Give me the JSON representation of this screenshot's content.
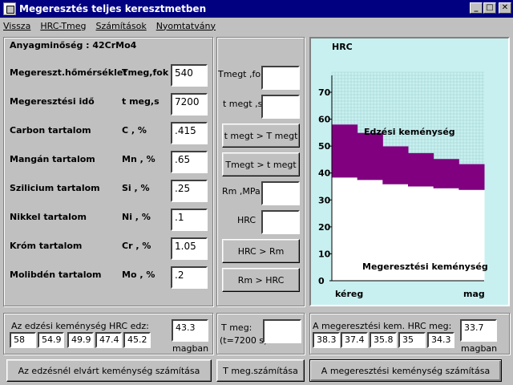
{
  "window": {
    "title": "Megeresztés teljes keresztmetben",
    "minimize": "_",
    "maximize": "□",
    "close": "✕"
  },
  "menu": [
    "Vissza",
    "HRC-Tmeg",
    "Számítások",
    "Nyomtatvány"
  ],
  "material": "Anyagminőség : 42CrMo4",
  "params": [
    {
      "label": "Megereszt.hőmérséklet",
      "symbol": "Tmeg,fok",
      "value": "540"
    },
    {
      "label": "Megeresztési idő",
      "symbol": "t meg,s",
      "value": "7200"
    },
    {
      "label": "Carbon tartalom",
      "symbol": "C    , %",
      "value": ".415"
    },
    {
      "label": "Mangán tartalom",
      "symbol": "Mn , %",
      "value": ".65"
    },
    {
      "label": "Szilicium tartalom",
      "symbol": "Si  , %",
      "value": ".25"
    },
    {
      "label": "Nikkel tartalom",
      "symbol": "Ni  , %",
      "value": ".1"
    },
    {
      "label": "Króm tartalom",
      "symbol": "Cr  , %",
      "value": "1.05"
    },
    {
      "label": "Molibdén tartalom",
      "symbol": "Mo , %",
      "value": ".2"
    }
  ],
  "middle": {
    "tmegt_fok": "Tmegt ,fok",
    "tmegt_s": "t megt ,s",
    "btn1": "t megt > T megt",
    "btn2": "Tmegt > t megt",
    "rm_mpa": "Rm ,MPa",
    "hrc": "HRC",
    "btn3": "HRC > Rm",
    "btn4": "Rm > HRC"
  },
  "chart_data": {
    "type": "area",
    "title": "HRC",
    "xlabel_left": "kéreg",
    "xlabel_right": "mag",
    "yticks": [
      "0",
      "10",
      "20",
      "30",
      "40",
      "50",
      "60",
      "70"
    ],
    "ylim": [
      0,
      70
    ],
    "upper_label": "Edzési keménység",
    "lower_label": "Megeresztési keménység",
    "upper": [
      58,
      54.9,
      49.9,
      47.4,
      45.2,
      43.3
    ],
    "lower": [
      38.3,
      37.4,
      35.8,
      35,
      34.3,
      33.7
    ],
    "colors": {
      "upper": "#800080",
      "lower": "#ffffff",
      "bg": "#c8f0f0"
    }
  },
  "bottom": {
    "edz_title": "Az edzési keménység HRC edz:",
    "edz_values": [
      "58",
      "54.9",
      "49.9",
      "47.4",
      "45.2"
    ],
    "edz_mag": "43.3",
    "magban": "magban",
    "tmeg_label": "T meg:",
    "tmeg_sub": "(t=7200 s)",
    "meg_title": "A megeresztési kem. HRC meg:",
    "meg_values": [
      "38.3",
      "37.4",
      "35.8",
      "35",
      "34.3"
    ],
    "meg_mag": "33.7"
  },
  "buttons": {
    "calc_edz": "Az edzésnél elvárt keménység számítása",
    "calc_tmeg": "T meg.számítása",
    "calc_meg": "A megeresztési keménység számítása"
  }
}
